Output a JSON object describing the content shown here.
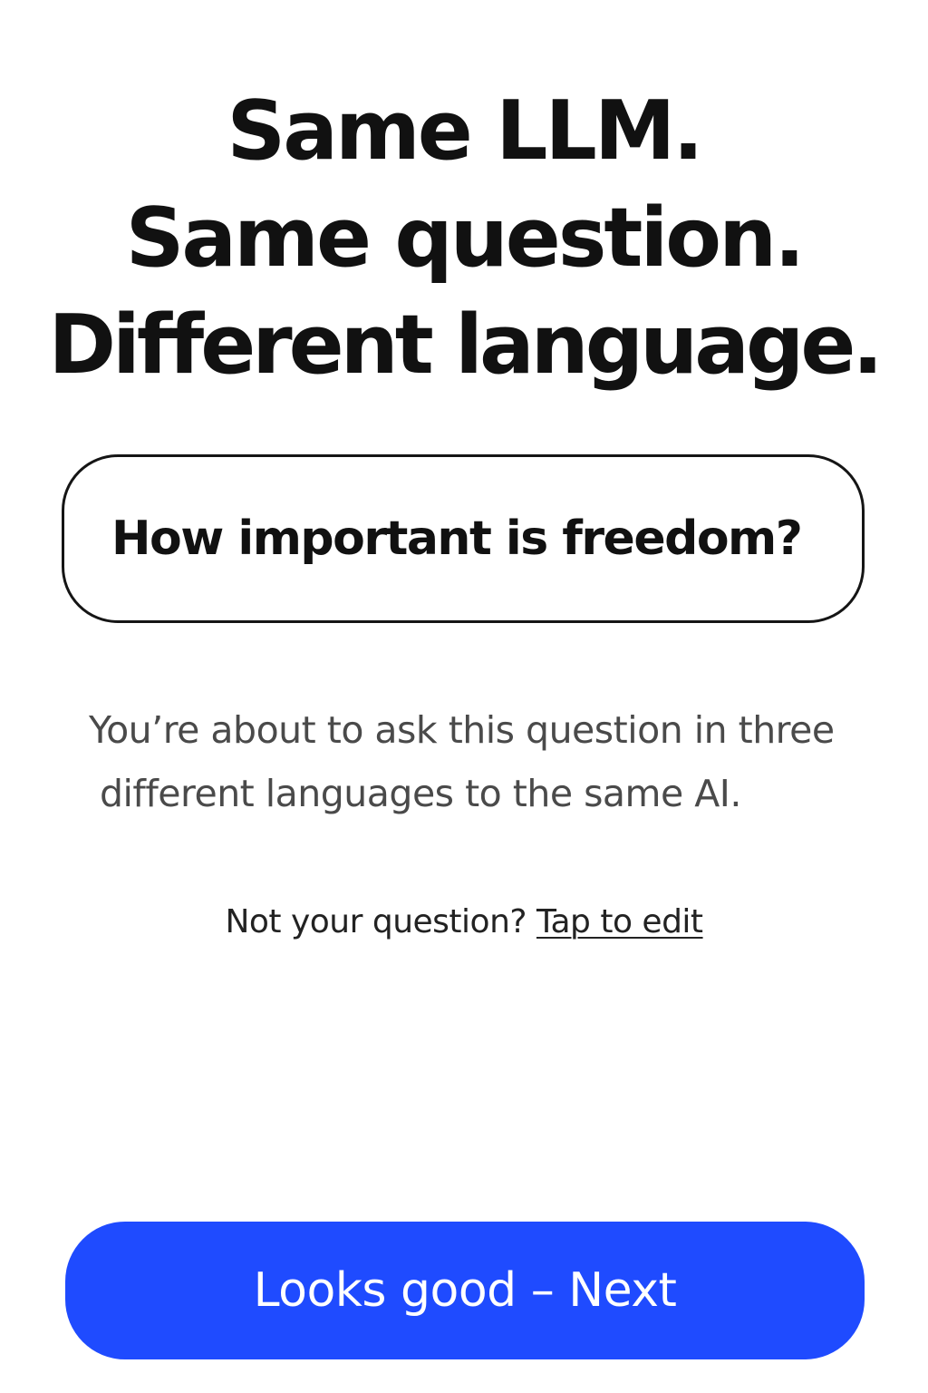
{
  "headline": {
    "line1": "Same LLM.",
    "line2": "Same question.",
    "line3": "Different language."
  },
  "question_card": {
    "text": "How important is freedom?"
  },
  "description": {
    "line1": "You’re about to ask this question in three",
    "line2": "different languages to the same AI."
  },
  "edit_prompt": {
    "text": "Not your question?",
    "link_label": "Tap to edit"
  },
  "next_button": {
    "label": "Looks good – Next"
  },
  "colors": {
    "accent": "#1f4bff",
    "text": "#111111",
    "secondary_text": "#4a4a4a",
    "background": "#ffffff"
  }
}
